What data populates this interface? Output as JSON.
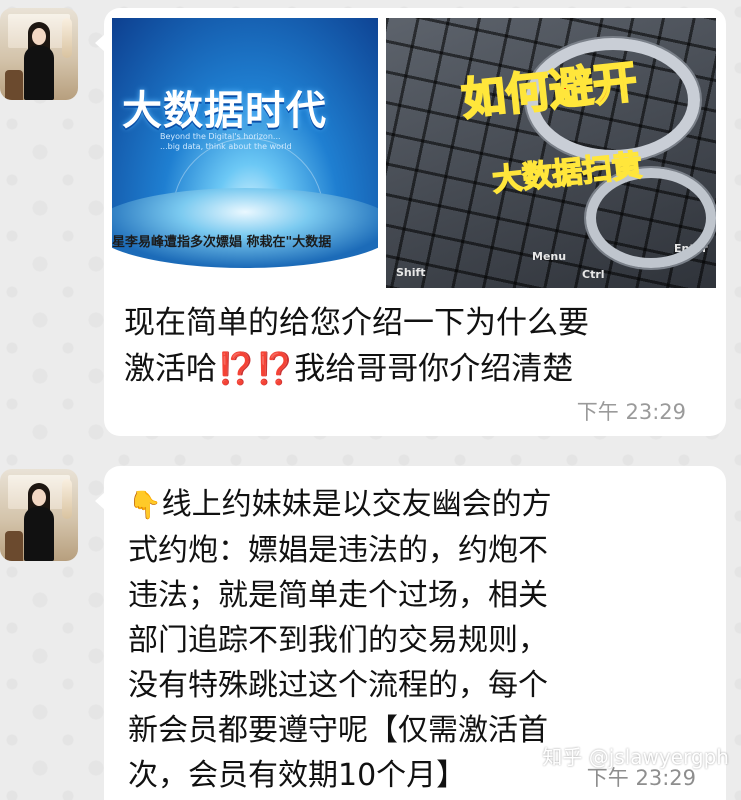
{
  "chat": {
    "messages": [
      {
        "images": [
          {
            "title": "大数据时代",
            "subtitle_line1": "Beyond the Digital's horizon...",
            "subtitle_line2": "...big data, think about the world",
            "caption": "星李易峰遭指多次嫖娼 称栽在\"大数据"
          },
          {
            "headline": "如何避开",
            "subhead": "大数据扫黄",
            "keys": [
              "Menu",
              "Ctrl",
              "Enter",
              "Shift"
            ]
          }
        ],
        "text_line1": "现在简单的给您介绍一下为什么要",
        "text_line2_a": "激活哈",
        "text_line2_mark": "⁉️⁉️",
        "text_line2_b": "我给哥哥你介绍清楚",
        "time": "下午  23:29"
      },
      {
        "emoji": "👇",
        "lines": [
          "线上约妹妹是以交友幽会的方",
          "式约炮：嫖娼是违法的，约炮不",
          "违法；就是简单走个过场，相关",
          "部门追踪不到我们的交易规则，",
          "没有特殊跳过这个流程的，每个",
          "新会员都要遵守呢【仅需激活首",
          "次，会员有效期10个月】"
        ],
        "time": "下午  23:29"
      }
    ]
  },
  "watermark": "知乎 @jslawyergph"
}
